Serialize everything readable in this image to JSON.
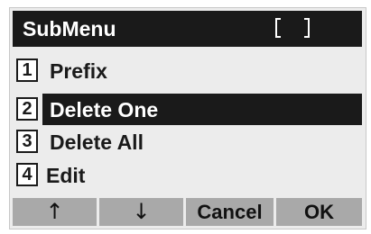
{
  "title": {
    "text": "SubMenu",
    "bracket_icon": "brackets-icon"
  },
  "menu": {
    "selected_index": 2,
    "items": [
      {
        "number": "1",
        "label": "Prefix"
      },
      {
        "number": "2",
        "label": "Delete One"
      },
      {
        "number": "3",
        "label": "Delete All"
      },
      {
        "number": "4",
        "label": "Edit"
      }
    ]
  },
  "softkeys": {
    "up": "↑",
    "down": "↓",
    "cancel": "Cancel",
    "ok": "OK"
  },
  "colors": {
    "screen_bg": "#ececec",
    "dark": "#1a1a1a",
    "softkey_bg": "#a9a9a9",
    "text_on_dark": "#ffffff"
  }
}
